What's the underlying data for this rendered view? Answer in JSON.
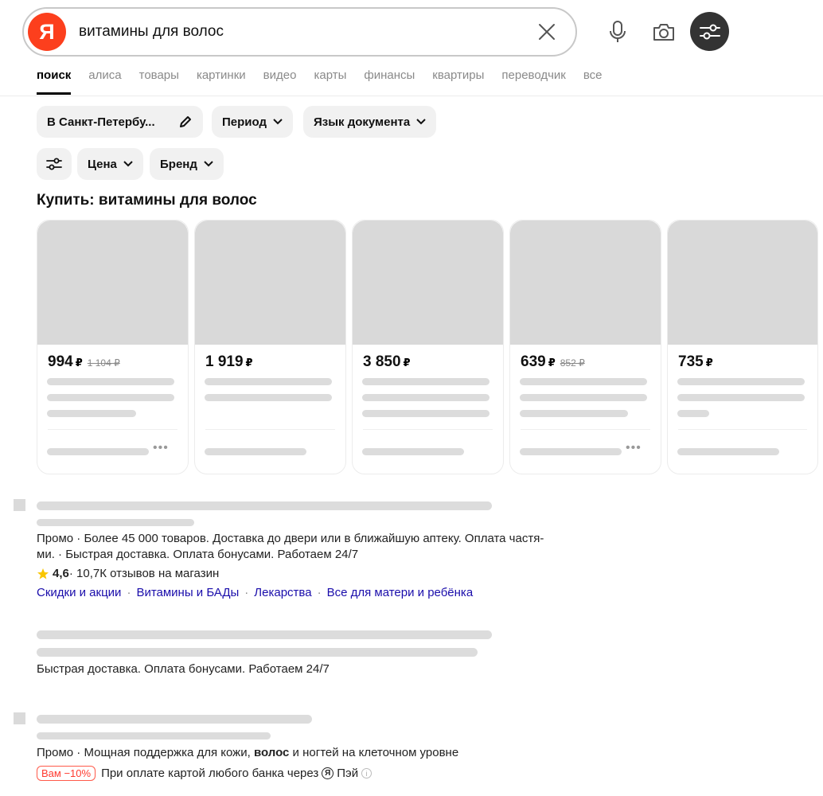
{
  "search": {
    "query": "витамины для волос",
    "logo_letter": "Я"
  },
  "tabs": [
    {
      "label": "поиск"
    },
    {
      "label": "алиса"
    },
    {
      "label": "товары"
    },
    {
      "label": "картинки"
    },
    {
      "label": "видео"
    },
    {
      "label": "карты"
    },
    {
      "label": "финансы"
    },
    {
      "label": "квартиры"
    },
    {
      "label": "переводчик"
    },
    {
      "label": "все"
    }
  ],
  "filters": {
    "region": "В Санкт-Петербу...",
    "period": "Период",
    "language": "Язык документа",
    "price": "Цена",
    "brand": "Бренд"
  },
  "shopping": {
    "title": "Купить: витамины для волос",
    "currency": "₽",
    "products": [
      {
        "price": "994",
        "old_price": "1 104 ₽"
      },
      {
        "price": "1 919",
        "old_price": ""
      },
      {
        "price": "3 850",
        "old_price": ""
      },
      {
        "price": "639",
        "old_price": "852 ₽"
      },
      {
        "price": "735",
        "old_price": ""
      }
    ]
  },
  "results": {
    "r1": {
      "snippet_line1": "Промо · Более 45 000 товаров. Доставка до двери или в ближайшую аптеку. Оплата частя-",
      "snippet_line2": "ми. · Быстрая доставка. Оплата бонусами. Работаем 24/7",
      "rating": "4,6",
      "reviews": " · 10,7К отзывов на магазин",
      "links": [
        "Скидки и акции",
        "Витамины и БАДы",
        "Лекарства",
        "Все для матери и ребёнка"
      ]
    },
    "r2": {
      "snippet": "Быстрая доставка. Оплата бонусами. Работаем 24/7"
    },
    "r3": {
      "snippet_prefix": "Промо · Мощная поддержка для кожи, ",
      "snippet_bold": "волос",
      "snippet_suffix": " и ногтей на клеточном уровне",
      "badge": "Вам −10%",
      "pay_text": "При оплате картой любого банка через",
      "pay_logo_letter": "Я",
      "pay_brand": "Пэй"
    }
  },
  "colors": {
    "brand_red": "#fc3f1d",
    "link_blue": "#1a0dab",
    "placeholder_gray": "#d9d9d9",
    "star": "#f9c600"
  }
}
